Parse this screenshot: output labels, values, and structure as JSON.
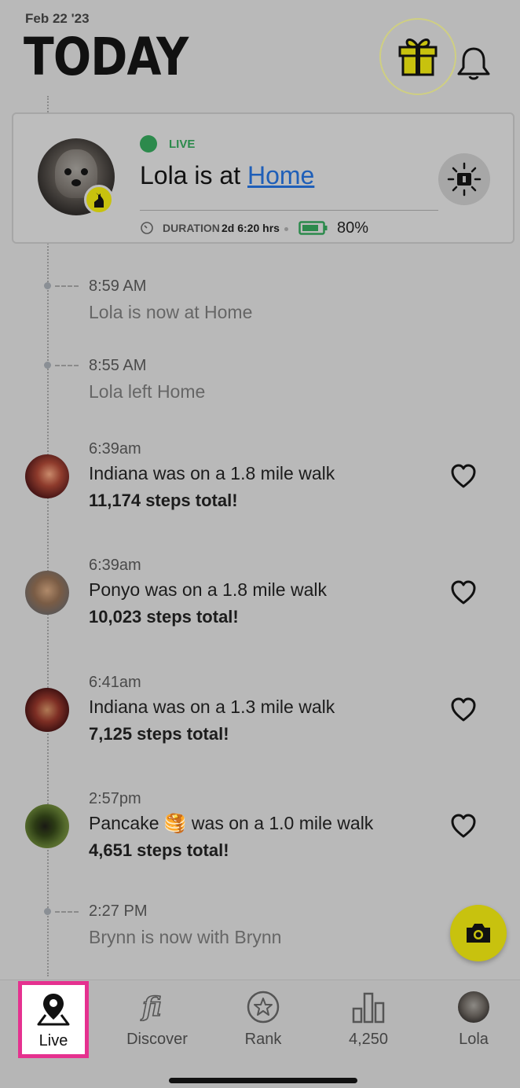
{
  "header": {
    "date": "Feb 22 '23",
    "title": "TODAY",
    "gift_icon": "gift-icon",
    "bell_icon": "bell-icon"
  },
  "live_card": {
    "status": "LIVE",
    "pet_name": "Lola",
    "at_prefix": "Lola is at ",
    "place": "Home",
    "duration_label": "DURATION",
    "duration_value": "2d 6:20 hrs",
    "battery": "80%",
    "battery_level": 0.8,
    "colors": {
      "live": "#2c8a4c",
      "accent": "#c8c20e",
      "link": "#1f5fb8"
    }
  },
  "events": [
    {
      "time": "8:59 AM",
      "text": "Lola is now at Home"
    },
    {
      "time": "8:55 AM",
      "text": "Lola left Home"
    }
  ],
  "feed": [
    {
      "time": "6:39am",
      "line1": "Indiana was on a 1.8 mile walk",
      "line2": "11,174 steps total!"
    },
    {
      "time": "6:39am",
      "line1": "Ponyo was on a 1.8 mile walk",
      "line2": "10,023 steps total!"
    },
    {
      "time": "6:41am",
      "line1": "Indiana was on a 1.3 mile walk",
      "line2": "7,125 steps total!"
    },
    {
      "time": "2:57pm",
      "line1": "Pancake 🥞 was on a 1.0 mile walk",
      "line2": "4,651 steps total!"
    }
  ],
  "last_event": {
    "time": "2:27 PM",
    "text": "Brynn is now with Brynn"
  },
  "tabs": [
    {
      "label": "Live",
      "icon": "map-pin-icon"
    },
    {
      "label": "Discover",
      "icon": "fi-logo-icon"
    },
    {
      "label": "Rank",
      "icon": "star-icon"
    },
    {
      "label": "4,250",
      "icon": "bar-chart-icon"
    },
    {
      "label": "Lola",
      "icon": "pet-avatar"
    }
  ]
}
